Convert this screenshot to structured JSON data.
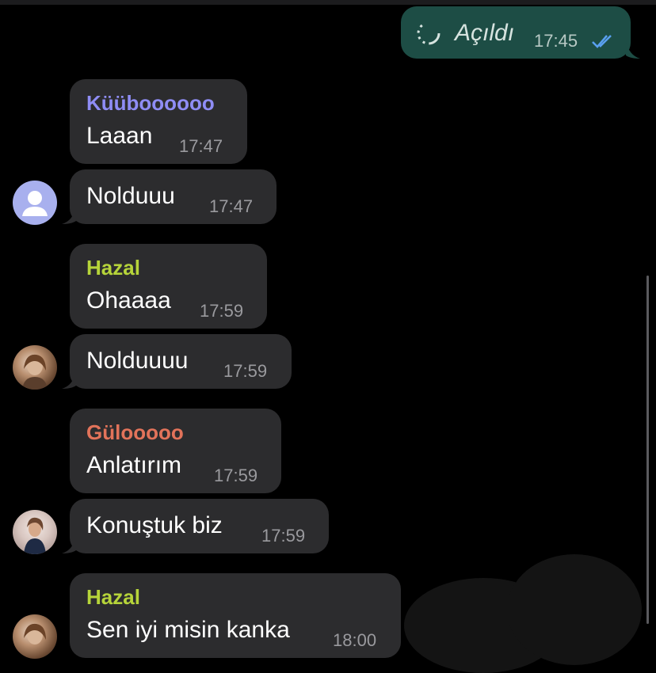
{
  "colors": {
    "incoming_bubble": "#2c2c2e",
    "outgoing_bubble": "#1d4d45",
    "sender_kuubo": "#8f8df5",
    "sender_hazal": "#b6d43a",
    "sender_gulooo": "#e2735a",
    "read_ticks": "#5aa0f0"
  },
  "outgoing": {
    "text": "Açıldı",
    "time": "17:45",
    "icon": "loading-icon",
    "status_icon": "double-check-icon"
  },
  "groups": [
    {
      "sender": "Küüboooooo",
      "avatar": "default-user-avatar",
      "messages": [
        {
          "text": "Laaan",
          "time": "17:47"
        },
        {
          "text": "Nolduuu",
          "time": "17:47"
        }
      ]
    },
    {
      "sender": "Hazal",
      "avatar": "hazal-photo-avatar",
      "messages": [
        {
          "text": "Ohaaaa",
          "time": "17:59"
        },
        {
          "text": "Nolduuuu",
          "time": "17:59"
        }
      ]
    },
    {
      "sender": "Gülooooo",
      "avatar": "gulooo-photo-avatar",
      "messages": [
        {
          "text": "Anlatırım",
          "time": "17:59"
        },
        {
          "text": "Konuştuk biz",
          "time": "17:59"
        }
      ]
    },
    {
      "sender": "Hazal",
      "avatar": "hazal-photo-avatar",
      "messages": [
        {
          "text": "Sen iyi misin kanka",
          "time": "18:00"
        }
      ]
    }
  ]
}
